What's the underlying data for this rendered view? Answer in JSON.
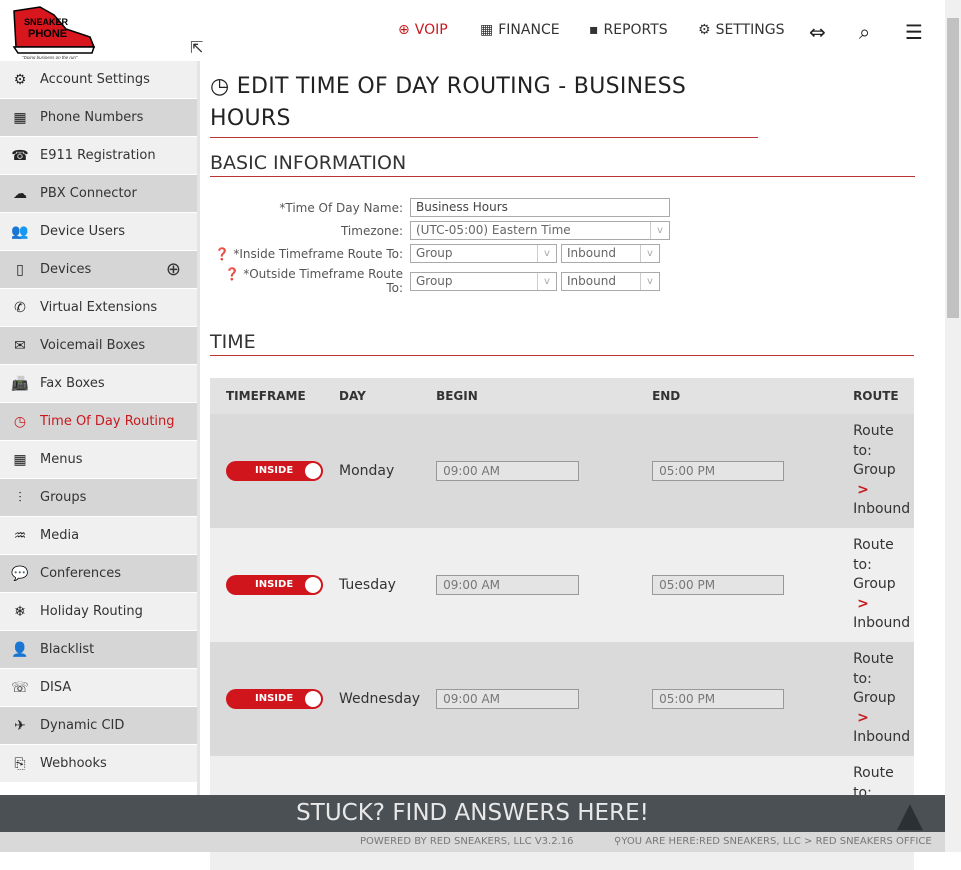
{
  "header": {
    "logo_text": "SNEAKER PHONE",
    "logo_tagline": "\"Doing business on the run\"",
    "nav": [
      {
        "label": "VOIP",
        "icon": "globe-icon",
        "active": true
      },
      {
        "label": "FINANCE",
        "icon": "calculator-icon"
      },
      {
        "label": "REPORTS",
        "icon": "report-icon"
      },
      {
        "label": "SETTINGS",
        "icon": "gears-icon"
      }
    ]
  },
  "sidebar": {
    "items": [
      {
        "label": "Account Settings",
        "icon": "⚙"
      },
      {
        "label": "Phone Numbers",
        "icon": "▦"
      },
      {
        "label": "E911 Registration",
        "icon": "☎"
      },
      {
        "label": "PBX Connector",
        "icon": "☁"
      },
      {
        "label": "Device Users",
        "icon": "👥"
      },
      {
        "label": "Devices",
        "icon": "▯"
      },
      {
        "label": "Virtual Extensions",
        "icon": "✆"
      },
      {
        "label": "Voicemail Boxes",
        "icon": "✉"
      },
      {
        "label": "Fax Boxes",
        "icon": "📠"
      },
      {
        "label": "Time Of Day Routing",
        "icon": "◷"
      },
      {
        "label": "Menus",
        "icon": "▦"
      },
      {
        "label": "Groups",
        "icon": "⫶"
      },
      {
        "label": "Media",
        "icon": "♒"
      },
      {
        "label": "Conferences",
        "icon": "💬"
      },
      {
        "label": "Holiday Routing",
        "icon": "❄"
      },
      {
        "label": "Blacklist",
        "icon": "👤"
      },
      {
        "label": "DISA",
        "icon": "☏"
      },
      {
        "label": "Dynamic CID",
        "icon": "✈"
      },
      {
        "label": "Webhooks",
        "icon": "⎘"
      }
    ],
    "active": "Time Of Day Routing"
  },
  "page": {
    "title": "EDIT TIME OF DAY ROUTING - BUSINESS HOURS",
    "basic_heading": "BASIC INFORMATION",
    "time_heading": "TIME"
  },
  "form": {
    "name_label": "*Time Of Day Name:",
    "name_value": "Business Hours",
    "tz_label": "Timezone:",
    "tz_value": "(UTC-05:00) Eastern Time",
    "inside_label": "*Inside Timeframe Route To:",
    "inside_type": "Group",
    "inside_target": "Inbound",
    "outside_label": "*Outside Timeframe Route To:",
    "outside_type": "Group",
    "outside_target": "Inbound"
  },
  "table": {
    "headers": [
      "TIMEFRAME",
      "DAY",
      "BEGIN",
      "END",
      "ROUTE"
    ],
    "rows": [
      {
        "timeframe": "INSIDE",
        "day": "Monday",
        "begin": "09:00 AM",
        "end": "05:00 PM",
        "route1": "Route",
        "route2": "to:",
        "route3": "Group",
        "route4": "Inbound"
      },
      {
        "timeframe": "INSIDE",
        "day": "Tuesday",
        "begin": "09:00 AM",
        "end": "05:00 PM",
        "route1": "Route",
        "route2": "to:",
        "route3": "Group",
        "route4": "Inbound"
      },
      {
        "timeframe": "INSIDE",
        "day": "Wednesday",
        "begin": "09:00 AM",
        "end": "05:00 PM",
        "route1": "Route",
        "route2": "to:",
        "route3": "Group",
        "route4": "Inbound"
      }
    ],
    "partial_row": {
      "route1": "Route",
      "route2": "to:"
    }
  },
  "footer": {
    "help": "STUCK? FIND ANSWERS HERE!",
    "powered": "POWERED BY RED SNEAKERS, LLC V3.2.16",
    "location_prefix": "YOU ARE HERE:",
    "location_company": "RED SNEAKERS, LLC",
    "location_office": "RED SNEAKERS OFFICE"
  },
  "colors": {
    "accent": "#c8191f",
    "footer": "#4b5054"
  }
}
